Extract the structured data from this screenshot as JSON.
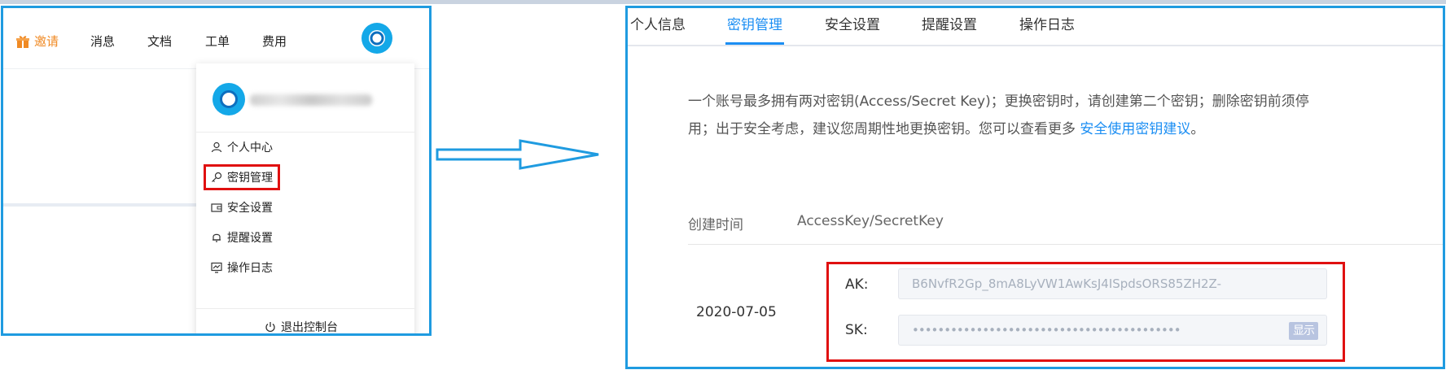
{
  "left_panel": {
    "header": {
      "invite_label": "邀请",
      "messages_label": "消息",
      "docs_label": "文档",
      "tickets_label": "工单",
      "billing_label": "费用"
    },
    "dropdown": {
      "items": [
        {
          "label": "个人中心",
          "icon": "user-icon"
        },
        {
          "label": "密钥管理",
          "icon": "key-icon"
        },
        {
          "label": "安全设置",
          "icon": "wallet-icon"
        },
        {
          "label": "提醒设置",
          "icon": "bell-icon"
        },
        {
          "label": "操作日志",
          "icon": "log-chart-icon"
        }
      ],
      "logout_label": "退出控制台"
    }
  },
  "right_panel": {
    "tabs": [
      {
        "label": "个人信息",
        "active": false
      },
      {
        "label": "密钥管理",
        "active": true
      },
      {
        "label": "安全设置",
        "active": false
      },
      {
        "label": "提醒设置",
        "active": false
      },
      {
        "label": "操作日志",
        "active": false
      }
    ],
    "description_line1": "一个账号最多拥有两对密钥(Access/Secret Key)；更换密钥时，请创建第二个密钥；删除密钥前须停",
    "description_line2": "用；出于安全考虑，建议您周期性地更换密钥。您可以查看更多 ",
    "description_link": "安全使用密钥建议",
    "description_end": "。",
    "table": {
      "col_created": "创建时间",
      "col_keys": "AccessKey/SecretKey",
      "row": {
        "date": "2020-07-05",
        "ak_label": "AK:",
        "ak_value": "B6NvfR2Gp_8mA8LyVW1AwKsJ4ISpdsORS85ZH2Z-",
        "sk_label": "SK:",
        "sk_value": "••••••••••••••••••••••••••••••••••••••••••",
        "show_label": "显示"
      }
    }
  },
  "colors": {
    "accent": "#1b8ef3",
    "frame": "#1f9be0",
    "highlight": "#e01010",
    "invite": "#f08a24"
  }
}
